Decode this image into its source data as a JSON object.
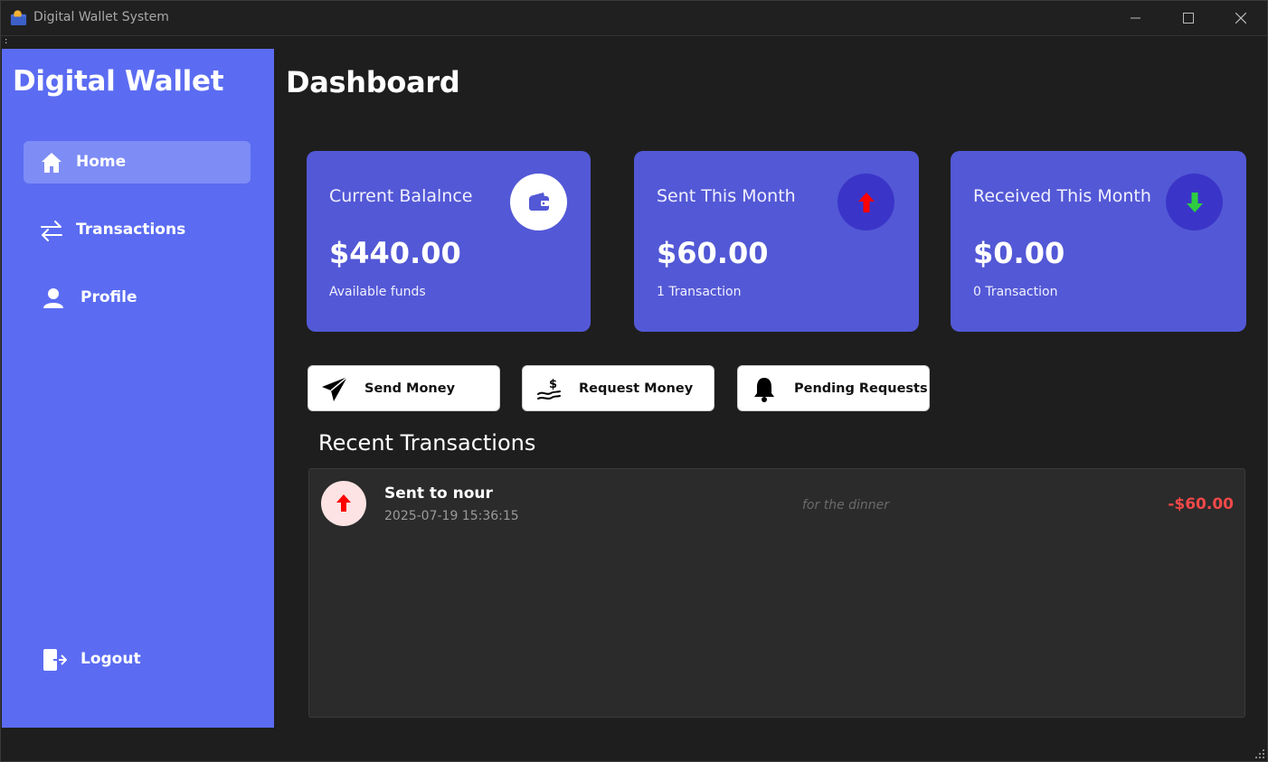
{
  "window": {
    "title": "Digital Wallet System",
    "menu_glyph": ":"
  },
  "sidebar": {
    "brand": "Digital Wallet",
    "items": [
      {
        "label": "Home",
        "icon": "home-icon",
        "active": true
      },
      {
        "label": "Transactions",
        "icon": "transfer-arrows-icon",
        "active": false
      },
      {
        "label": "Profile",
        "icon": "user-icon",
        "active": false
      }
    ],
    "logout": {
      "label": "Logout",
      "icon": "logout-icon"
    }
  },
  "main": {
    "title": "Dashboard",
    "cards": [
      {
        "title": "Current Balalnce",
        "value": "$440.00",
        "subtitle": "Available funds",
        "icon": "wallet-icon"
      },
      {
        "title": "Sent This Month",
        "value": "$60.00",
        "subtitle": "1 Transaction",
        "icon": "arrow-up-icon"
      },
      {
        "title": "Received This Month",
        "value": "$0.00",
        "subtitle": "0 Transaction",
        "icon": "arrow-down-icon"
      }
    ],
    "actions": [
      {
        "label": "Send Money",
        "icon": "paper-plane-icon"
      },
      {
        "label": "Request Money",
        "icon": "hand-dollar-icon"
      },
      {
        "label": "Pending Requests",
        "icon": "bell-icon"
      }
    ],
    "recent": {
      "title": "Recent Transactions",
      "transactions": [
        {
          "title": "Sent to nour",
          "date": "2025-07-19 15:36:15",
          "note": "for the dinner",
          "amount": "-$60.00",
          "icon": "arrow-up-icon"
        }
      ]
    }
  },
  "colors": {
    "sidebar_bg": "#5b6cf2",
    "card_bg": "#5358d6",
    "badge_dark": "#3a35c8",
    "negative": "#f04848",
    "up_arrow": "#ff0000",
    "down_arrow": "#2ecc40"
  }
}
